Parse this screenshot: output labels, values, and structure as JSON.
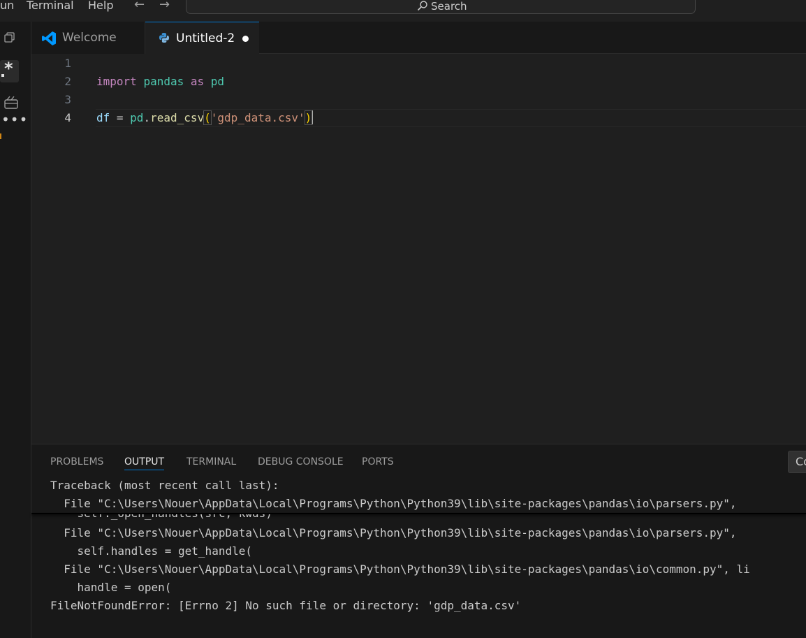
{
  "menubar": {
    "items": [
      "un",
      "Terminal",
      "Help"
    ]
  },
  "search": {
    "label": "Search"
  },
  "tabs": [
    {
      "label": "Welcome",
      "icon": "vscode-icon",
      "active": false
    },
    {
      "label": "Untitled-2",
      "icon": "python-icon",
      "active": true,
      "dirty": true
    }
  ],
  "activitybar": {
    "icons": [
      "copy-icon",
      "regex-icon",
      "kernel-icon",
      "more-icon"
    ]
  },
  "editor": {
    "line_numbers": [
      "1",
      "2",
      "3",
      "4"
    ],
    "active_line": "4",
    "line2": {
      "kw1": "import",
      "mod": "pandas",
      "kw2": "as",
      "alias": "pd"
    },
    "line4": {
      "var": "df",
      "eq": " = ",
      "obj": "pd",
      "dot": ".",
      "fn": "read_csv",
      "open": "(",
      "str": "'gdp_data.csv'",
      "close": ")"
    }
  },
  "panel": {
    "tabs": [
      "PROBLEMS",
      "OUTPUT",
      "TERMINAL",
      "DEBUG CONSOLE",
      "PORTS"
    ],
    "active_tab": "OUTPUT",
    "button_label": "Co",
    "output_lines": [
      "Traceback (most recent call last):",
      "  File \"C:\\Users\\Nouer\\AppData\\Local\\Programs\\Python\\Python39\\lib\\site-packages\\pandas\\io\\parsers.py\", ",
      "    self._open_handles(src, kwds)",
      "  File \"C:\\Users\\Nouer\\AppData\\Local\\Programs\\Python\\Python39\\lib\\site-packages\\pandas\\io\\parsers.py\", ",
      "    self.handles = get_handle(",
      "  File \"C:\\Users\\Nouer\\AppData\\Local\\Programs\\Python\\Python39\\lib\\site-packages\\pandas\\io\\common.py\", li",
      "    handle = open(",
      "FileNotFoundError: [Errno 2] No such file or directory: 'gdp_data.csv'"
    ]
  },
  "colors": {
    "accent": "#0078d4",
    "keyword": "#c586c0",
    "module": "#4ec9b0",
    "variable": "#9cdcfe",
    "function": "#dcdcaa",
    "string": "#ce9178",
    "bracket": "#ffd700"
  }
}
